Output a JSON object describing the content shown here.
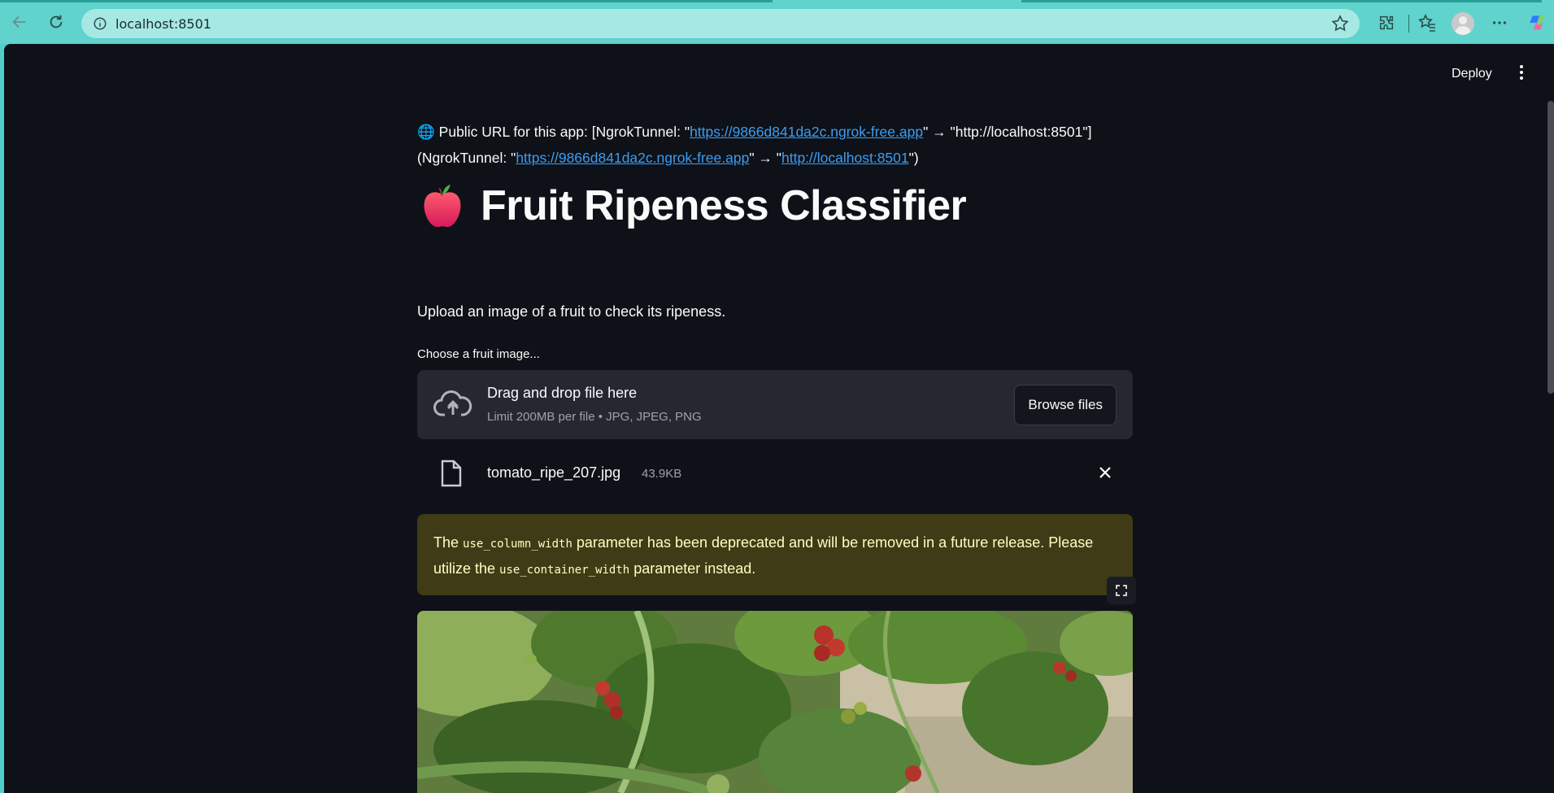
{
  "browser": {
    "address": "localhost:8501"
  },
  "header": {
    "deploy_label": "Deploy"
  },
  "content": {
    "url_intro": "Public URL for this app: [NgrokTunnel: \"",
    "url_link1": "https://9866d841da2c.ngrok-free.app",
    "url_mid1": "\" → \"http://localhost:8501\"](NgrokTunnel: \"",
    "url_link2": "https://9866d841da2c.ngrok-free.app",
    "url_mid2": "\" → \"",
    "url_link3": "http://localhost:8501",
    "url_end": "\")",
    "title": "Fruit Ripeness Classifier",
    "subtitle": "Upload an image of a fruit to check its ripeness.",
    "uploader_label": "Choose a fruit image...",
    "dropzone_title": "Drag and drop file here",
    "dropzone_limit": "Limit 200MB per file • JPG, JPEG, PNG",
    "browse_label": "Browse files",
    "file_name": "tomato_ripe_207.jpg",
    "file_size": "43.9KB",
    "warning_pre": "The ",
    "warning_code1": "use_column_width",
    "warning_mid": " parameter has been deprecated and will be removed in a future release. Please utilize the ",
    "warning_code2": "use_container_width",
    "warning_post": " parameter instead."
  },
  "colors": {
    "app_background": "#0e1117",
    "link": "#3d9df3",
    "warning_background": "#3e3b16",
    "warning_text": "#ffffc2"
  }
}
